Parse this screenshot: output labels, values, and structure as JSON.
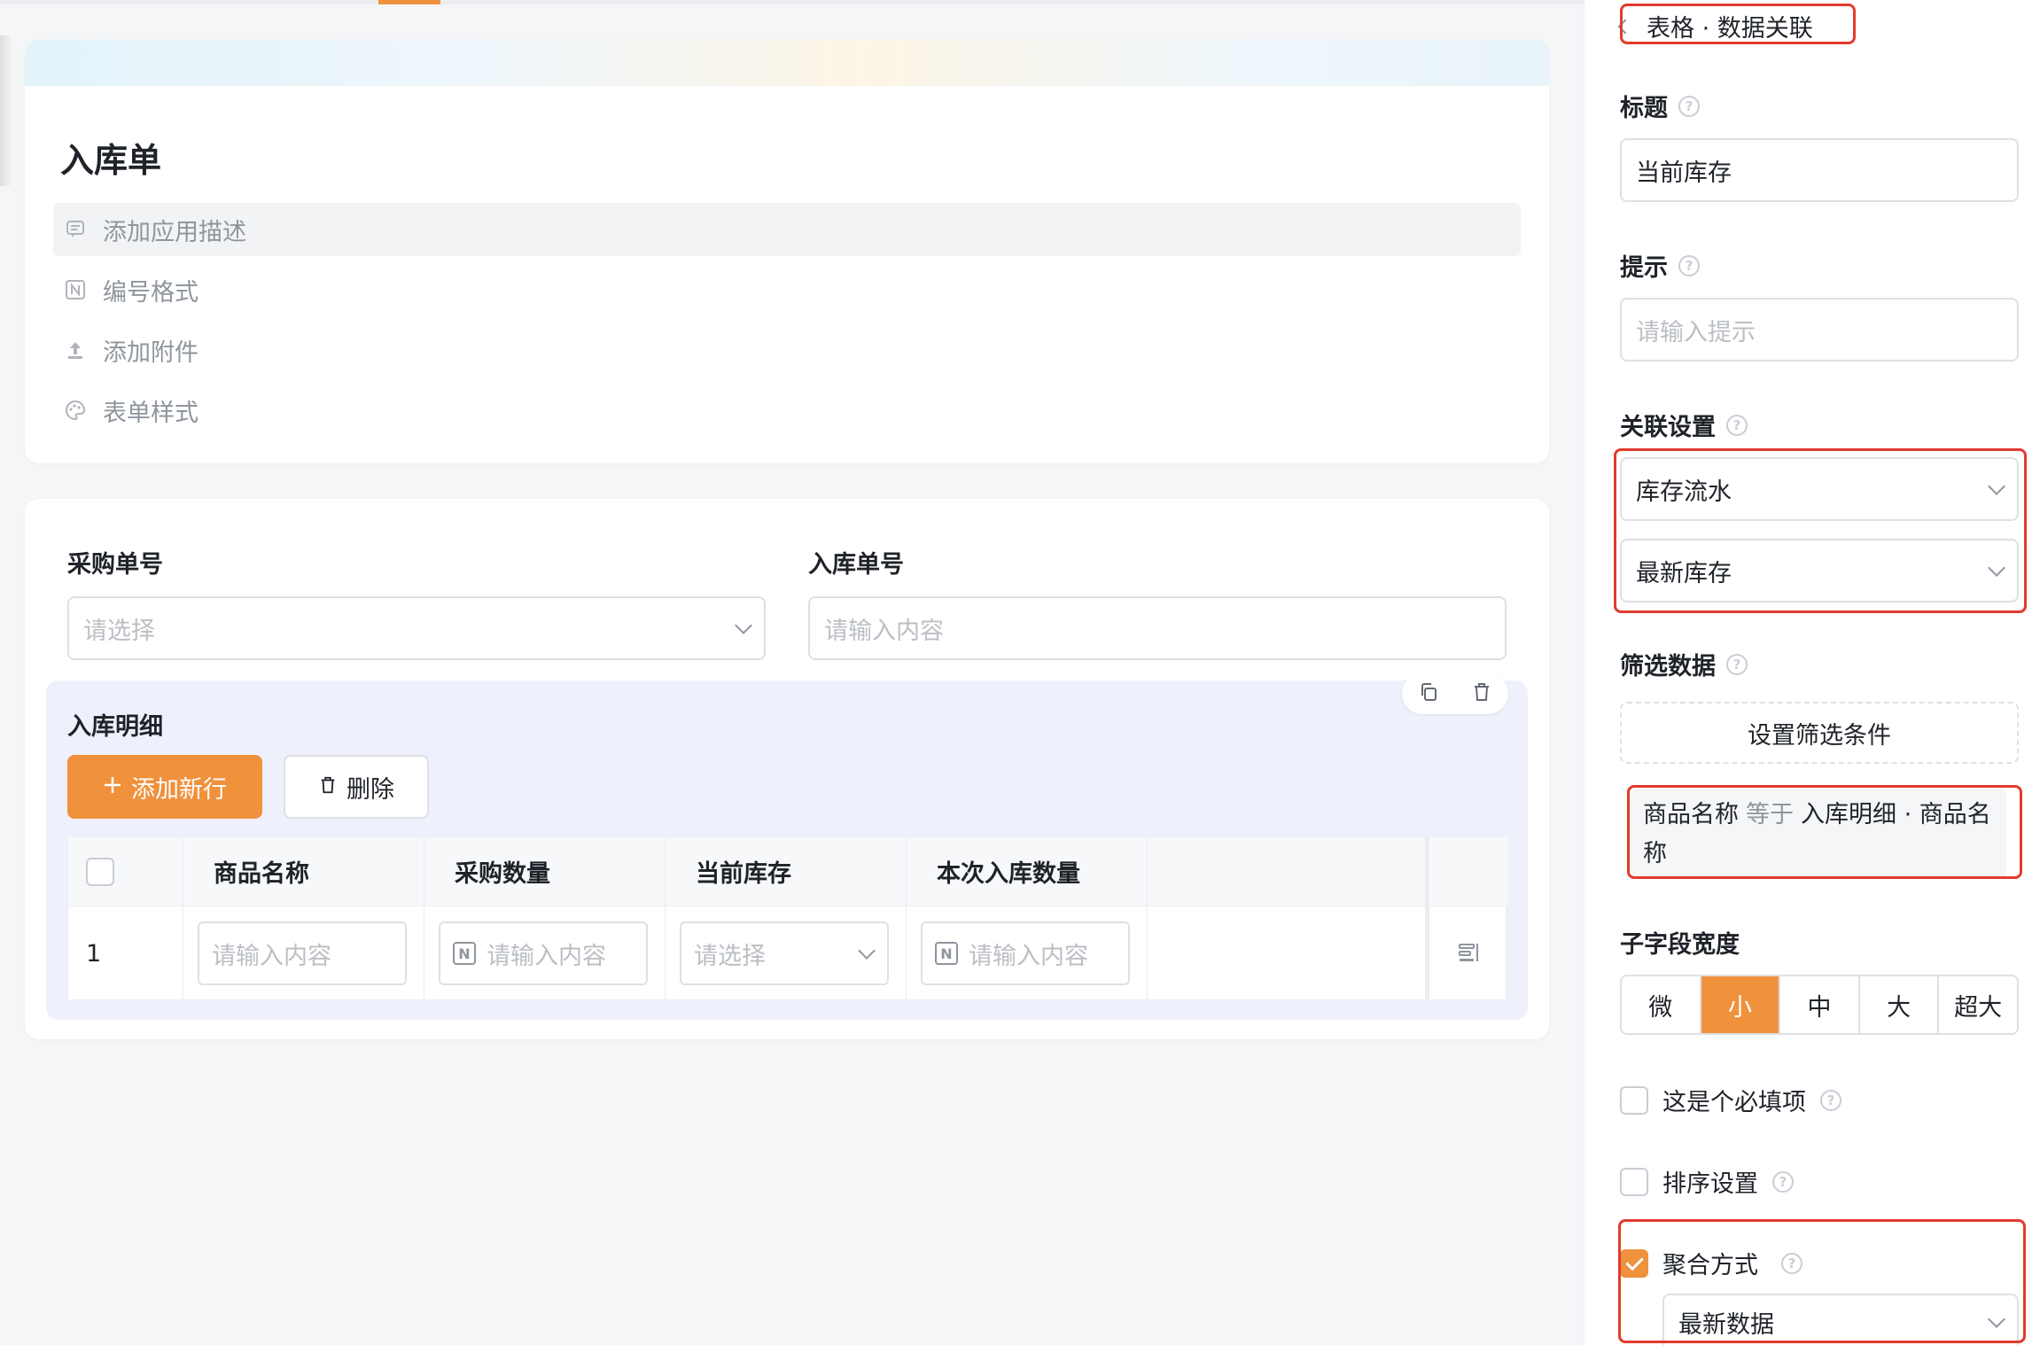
{
  "form": {
    "title": "入库单",
    "options": [
      {
        "label": "添加应用描述",
        "icon": "comment-icon"
      },
      {
        "label": "编号格式",
        "icon": "number-format-icon"
      },
      {
        "label": "添加附件",
        "icon": "upload-icon"
      },
      {
        "label": "表单样式",
        "icon": "palette-icon"
      }
    ],
    "fields": {
      "purchase_no": {
        "label": "采购单号",
        "placeholder": "请选择"
      },
      "inbound_no": {
        "label": "入库单号",
        "placeholder": "请输入内容"
      }
    },
    "subtable": {
      "title": "入库明细",
      "add_row": "添加新行",
      "delete": "删除",
      "columns": [
        "商品名称",
        "采购数量",
        "当前库存",
        "本次入库数量"
      ],
      "row": {
        "index": "1",
        "cells": [
          "请输入内容",
          "请输入内容",
          "请选择",
          "请输入内容"
        ]
      }
    }
  },
  "panel": {
    "breadcrumb": "表格 · 数据关联",
    "title_label": "标题",
    "title_value": "当前库存",
    "hint_label": "提示",
    "hint_placeholder": "请输入提示",
    "link_label": "关联设置",
    "link_source": "库存流水",
    "link_field": "最新库存",
    "filter_label": "筛选数据",
    "filter_button": "设置筛选条件",
    "filter_condition": {
      "field": "商品名称",
      "operator": "等于",
      "value": "入库明细 · 商品名称"
    },
    "width_label": "子字段宽度",
    "width_options": [
      "微",
      "小",
      "中",
      "大",
      "超大"
    ],
    "width_selected": "小",
    "required_label": "这是个必填项",
    "sort_label": "排序设置",
    "aggregate_label": "聚合方式",
    "aggregate_value": "最新数据"
  },
  "colors": {
    "accent": "#f0913c",
    "highlight_border": "#e23b2e"
  }
}
